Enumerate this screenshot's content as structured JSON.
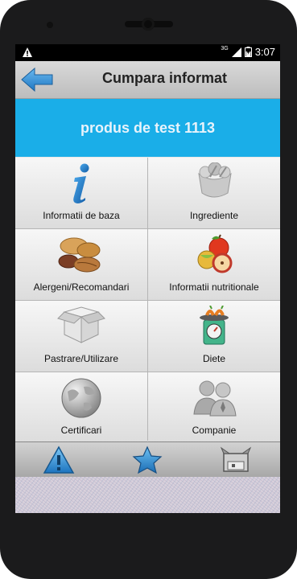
{
  "status_bar": {
    "network": "3G",
    "time": "3:07"
  },
  "header": {
    "title": "Cumpara informat"
  },
  "product": {
    "name": "produs de test 1113"
  },
  "menu": {
    "items": [
      {
        "label": "Informatii de baza",
        "icon": "info-icon"
      },
      {
        "label": "Ingrediente",
        "icon": "ingredients-icon"
      },
      {
        "label": "Alergeni/Recomandari",
        "icon": "nuts-icon"
      },
      {
        "label": "Informatii nutritionale",
        "icon": "fruits-icon"
      },
      {
        "label": "Pastrare/Utilizare",
        "icon": "box-icon"
      },
      {
        "label": "Diete",
        "icon": "scale-icon"
      },
      {
        "label": "Certificari",
        "icon": "globe-icon"
      },
      {
        "label": "Companie",
        "icon": "people-icon"
      }
    ]
  },
  "bottom_bar": {
    "buttons": [
      {
        "icon": "warning-icon"
      },
      {
        "icon": "star-icon"
      },
      {
        "icon": "scanner-icon"
      }
    ]
  },
  "colors": {
    "banner": "#1aaee8",
    "back_arrow": "#2f8fd3"
  }
}
